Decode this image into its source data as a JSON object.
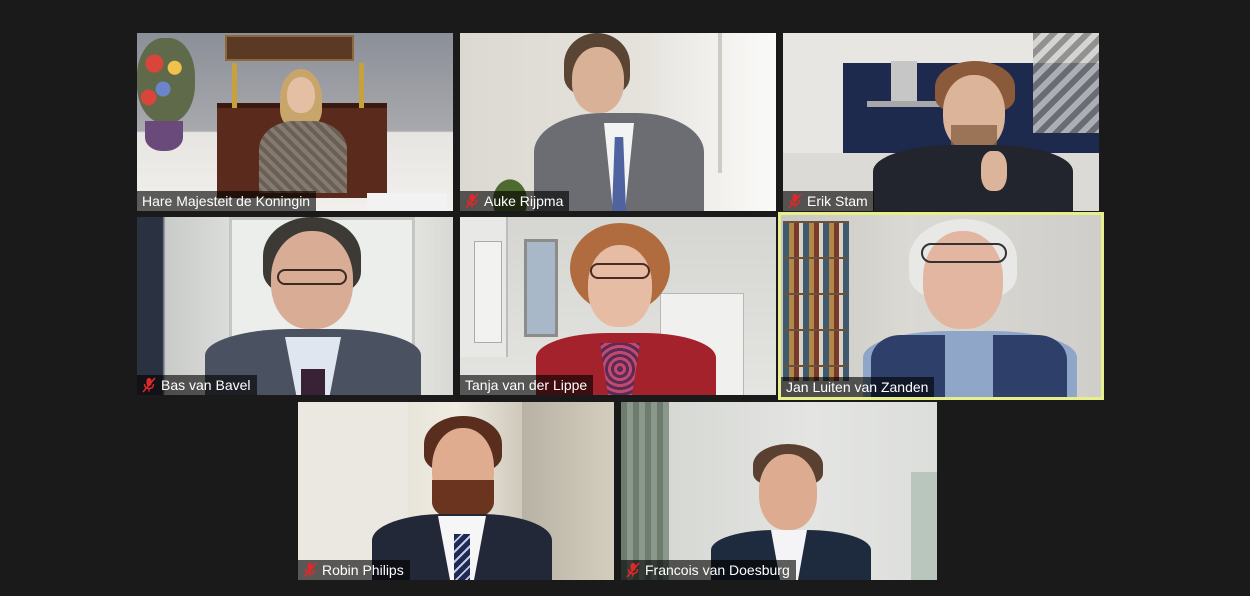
{
  "participants": [
    {
      "name": "Hare Majesteit de Koningin",
      "muted": false,
      "speaking": false
    },
    {
      "name": "Auke Rijpma",
      "muted": true,
      "speaking": false
    },
    {
      "name": "Erik Stam",
      "muted": true,
      "speaking": false
    },
    {
      "name": "Bas van Bavel",
      "muted": true,
      "speaking": false
    },
    {
      "name": "Tanja van der Lippe",
      "muted": false,
      "speaking": false
    },
    {
      "name": "Jan Luiten van Zanden",
      "muted": false,
      "speaking": true
    },
    {
      "name": "Robin Philips",
      "muted": true,
      "speaking": false
    },
    {
      "name": "Francois van Doesburg",
      "muted": true,
      "speaking": false
    }
  ],
  "colors": {
    "background": "#1a1a1a",
    "active_speaker_border": "#e7ef8a",
    "muted_icon": "#e02828"
  },
  "icons": {
    "muted": "microphone-muted-icon"
  }
}
